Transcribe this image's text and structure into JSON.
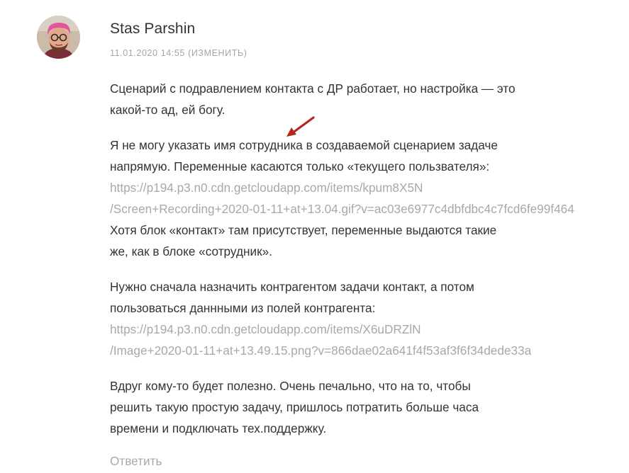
{
  "comment": {
    "author": "Stas Parshin",
    "date": "11.01.2020 14:55",
    "edit_label": "(ИЗМЕНИТЬ)",
    "reply_label": "Ответить",
    "paragraphs": {
      "p1": {
        "l1": "Сценарий с подравлением контакта с ДР работает, но настройка — это",
        "l2": "какой-то ад, ей богу."
      },
      "p2": {
        "l1": "Я не могу указать имя сотрудника в создаваемой сценарием задаче",
        "l2": "напрямую. Переменные касаются только «текущего пользвателя»:",
        "url1": "https://p194.p3.n0.cdn.getcloudapp.com/items/kpum8X5N",
        "url2": "/Screen+Recording+2020-01-11+at+13.04.gif?v=ac03e6977c4dbfdbc4c7fcd6fe99f464",
        "l3": "Хотя блок «контакт» там присутствует, переменные выдаются такие",
        "l4": "же, как в блоке «сотрудник»."
      },
      "p3": {
        "l1": "Нужно сначала назначить контрагентом задачи контакт, а потом",
        "l2": "пользоваться даннными из полей контрагента:",
        "url1": "https://p194.p3.n0.cdn.getcloudapp.com/items/X6uDRZlN",
        "url2": "/Image+2020-01-11+at+13.49.15.png?v=866dae02a641f4f53af3f6f34dede33a"
      },
      "p4": {
        "l1": "Вдруг кому-то будет полезно. Очень печально, что на то, чтобы",
        "l2": "решить такую простую задачу, пришлось потратить больше часа",
        "l3": "времени и подключать тех.поддержку."
      }
    }
  },
  "colors": {
    "text": "#333333",
    "muted": "#a8a8a8",
    "arrow": "#b5261e"
  },
  "icons": {
    "avatar": "user-avatar",
    "arrow": "red-arrow-annotation-icon"
  }
}
